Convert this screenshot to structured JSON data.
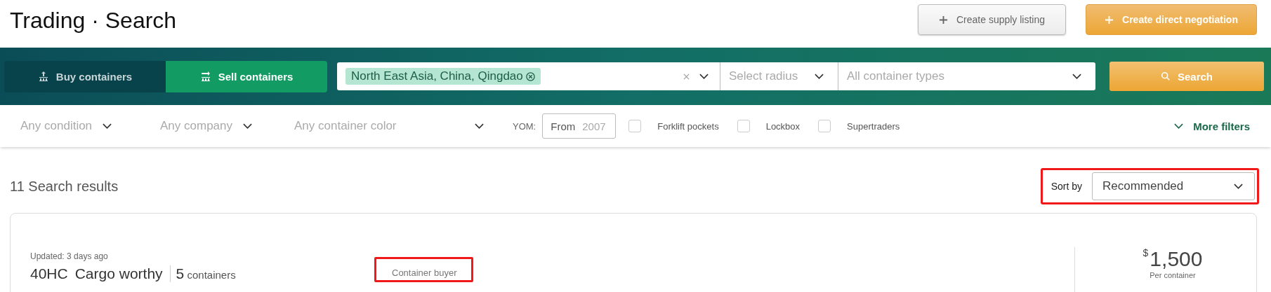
{
  "header": {
    "title": "Trading · Search",
    "buttons": [
      {
        "label": "Create supply listing",
        "kind": "secondary"
      },
      {
        "label": "Create direct negotiation",
        "kind": "primary"
      }
    ]
  },
  "search_bar": {
    "tabs": [
      {
        "label": "Buy containers",
        "selected": false
      },
      {
        "label": "Sell containers",
        "selected": true
      }
    ],
    "location": {
      "tag": "North East Asia, China, Qingdao"
    },
    "radius": {
      "placeholder": "Select radius"
    },
    "container_types": {
      "placeholder": "All container types"
    },
    "search_button": "Search"
  },
  "filters": {
    "dropdowns": [
      "Any condition",
      "Any company",
      "Any container color"
    ],
    "yom": {
      "label": "YOM:",
      "prefix": "From",
      "placeholder": "2007"
    },
    "checkboxes": [
      {
        "label": "Forklift pockets",
        "checked": false
      },
      {
        "label": "Lockbox",
        "checked": false
      },
      {
        "label": "Supertraders",
        "checked": false
      }
    ],
    "more": "More filters"
  },
  "results": {
    "count_label": "11 Search results",
    "sort": {
      "label": "Sort by",
      "value": "Recommended",
      "highlighted": true
    }
  },
  "listings": [
    {
      "updated": "Updated: 3 days ago",
      "type": "40HC",
      "condition": "Cargo worthy",
      "quantity": "5",
      "quantity_unit": "containers",
      "role": "Container buyer",
      "role_highlighted": true,
      "currency": "$",
      "price": "1,500",
      "price_unit": "Per container"
    }
  ]
}
